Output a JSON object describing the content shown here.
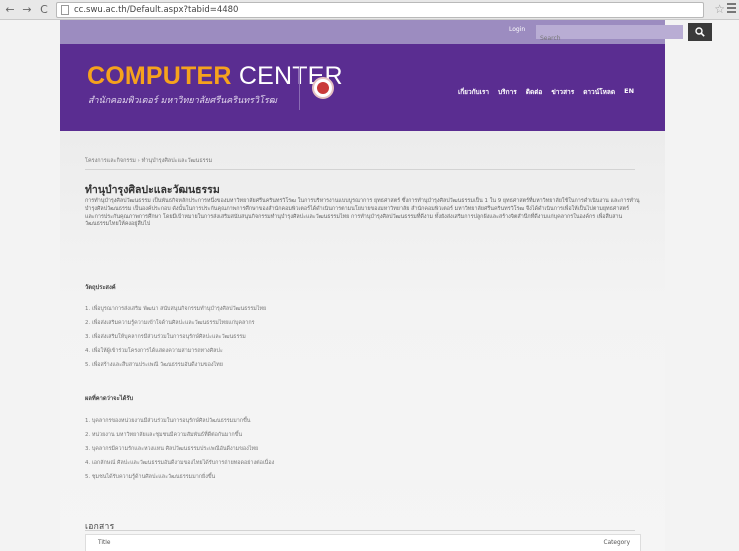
{
  "browser": {
    "url": "cc.swu.ac.th/Default.aspx?tabid=4480"
  },
  "utility": {
    "login": "Login",
    "search_placeholder": "Search"
  },
  "header": {
    "logo_word1": "COMPUTER",
    "logo_word2": "CENTER",
    "subtitle": "สำนักคอมพิวเตอร์ มหาวิทยาลัยศรีนครินทรวิโรฒ",
    "nav": [
      "เกี่ยวกับเรา",
      "บริการ",
      "ติดต่อ",
      "ข่าวสาร",
      "ดาวน์โหลด",
      "EN"
    ]
  },
  "breadcrumb": "โครงการและกิจกรรม  ›  ทำนุบำรุงศิลปะและวัฒนธรรม",
  "page": {
    "title": "ทำนุบำรุงศิลปะและวัฒนธรรม",
    "intro": "การทำนุบำรุงศิลปวัฒนธรรม เป็นพันธกิจหลักประการหนึ่งของมหาวิทยาลัยศรีนครินทรวิโรฒ ในการบริหารงานแบบบูรณาการ ยุทธศาสตร์ ซึ่งการทำนุบำรุงศิลปวัฒนธรรมเป็น 1 ใน 9 ยุทธศาสตร์ที่มหาวิทยาลัยใช้ในการดำเนินงาน และการทำนุบำรุงศิลปวัฒนธรรม เป็นองค์ประกอบ ดังนั้นในการประกันคุณภาพการศึกษาของสำนักคอมพิวเตอร์ได้ดำเนินการตามนโยบายของมหาวิทยาลัย สำนักคอมพิวเตอร์ มหาวิทยาลัยศรีนครินทรวิโรฒ จึงได้ดำเนินการเพื่อให้เป็นไปตามยุทธศาสตร์ และการประกันคุณภาพการศึกษา โดยมีเป้าหมายในการส่งเสริมสนับสนุนกิจกรรมทำนุบำรุงศิลปะและวัฒนธรรมไทย การทำนุบำรุงศิลปวัฒนธรรมที่ดีงาม ทั้งยังส่งเสริมการปลูกฝังและสร้างจิตสำนึกที่ดีงามแก่บุคลากรในองค์กร เพื่อสืบสานวัฒนธรรมไทยให้คงอยู่สืบไป",
    "objectives_heading": "วัตถุประสงค์",
    "objectives": [
      "1. เพื่อบูรณาการส่งเสริม พัฒนา สนับสนุนกิจกรรมทำนุบำรุงศิลปวัฒนธรรมไทย",
      "2. เพื่อส่งเสริมความรู้ความเข้าใจด้านศิลปะและวัฒนธรรมไทยแก่บุคลากร",
      "3. เพื่อส่งเสริมให้บุคลากรมีส่วนร่วมในการอนุรักษ์ศิลปะและวัฒนธรรม",
      "4. เพื่อให้ผู้เข้าร่วมโครงการได้แสดงความสามารถทางศิลปะ",
      "5. เพื่อสร้างและสืบสานประเพณี วัฒนธรรมอันดีงามของไทย"
    ],
    "results_heading": "ผลที่คาดว่าจะได้รับ",
    "results": [
      "1. บุคลากรของหน่วยงานมีส่วนร่วมในการอนุรักษ์ศิลปวัฒนธรรมมากขึ้น",
      "2. หน่วยงาน มหาวิทยาลัยและชุมชนมีความสัมพันธ์ที่ดีต่อกันมากขึ้น",
      "3. บุคลากรมีความรักและหวงแหน ศิลปวัฒนธรรมประเพณีอันดีงามของไทย",
      "4. เอกลักษณ์ ศิลปะและวัฒนธรรมอันดีงามของไทยได้รับการถ่ายทอดอย่างต่อเนื่อง",
      "5. ชุมชนได้รับความรู้ด้านศิลปะและวัฒนธรรมมากยิ่งขึ้น"
    ],
    "documents_heading": "เอกสาร",
    "table": {
      "col_title": "Title",
      "col_category": "Category"
    }
  }
}
